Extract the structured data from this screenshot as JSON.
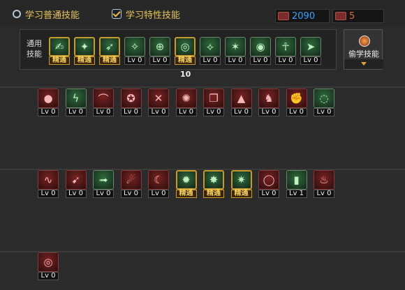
{
  "tabs": [
    {
      "label": "学习普通技能",
      "selected": false
    },
    {
      "label": "学习特性技能",
      "selected": true
    }
  ],
  "resources": {
    "sp": "2090",
    "tp": "5",
    "sp_color": "#3aa0ff",
    "tp_color": "#e56a2a"
  },
  "general": {
    "label": "通用技能",
    "slots": [
      {
        "icon": "scroll-man-icon",
        "tier": "gold",
        "level": "精通"
      },
      {
        "icon": "flame-arm-icon",
        "tier": "gold",
        "level": "精通"
      },
      {
        "icon": "runner-icon",
        "tier": "gold",
        "level": "精通"
      },
      {
        "icon": "wings-icon",
        "tier": "green",
        "level": "Lv 0"
      },
      {
        "icon": "crosshair-icon",
        "tier": "green",
        "level": "Lv 0"
      },
      {
        "icon": "target-icon",
        "tier": "gold",
        "level": "精通"
      },
      {
        "icon": "kick-icon",
        "tier": "green",
        "level": "Lv 0"
      },
      {
        "icon": "leap-icon",
        "tier": "green",
        "level": "Lv 0"
      },
      {
        "icon": "eye-icon",
        "tier": "green",
        "level": "Lv 0"
      },
      {
        "icon": "figure-icon",
        "tier": "green",
        "level": "Lv 0"
      },
      {
        "icon": "dash-icon",
        "tier": "green",
        "level": "Lv 0"
      }
    ],
    "count": "10"
  },
  "steal": {
    "label": "偷学技能"
  },
  "rows": [
    [
      {
        "icon": "orb-icon",
        "tier": "red",
        "level": "Lv 0"
      },
      {
        "icon": "lightning-figure-icon",
        "tier": "green",
        "level": "Lv 0"
      },
      {
        "icon": "bow-icon",
        "tier": "red",
        "level": "Lv 0"
      },
      {
        "icon": "emblem-icon",
        "tier": "red",
        "level": "Lv 0"
      },
      {
        "icon": "slash-cross-icon",
        "tier": "red",
        "level": "Lv 0"
      },
      {
        "icon": "burst-icon",
        "tier": "red",
        "level": "Lv 0"
      },
      {
        "icon": "book-icon",
        "tier": "red",
        "level": "Lv 0"
      },
      {
        "icon": "tower-icon",
        "tier": "red",
        "level": "Lv 0"
      },
      {
        "icon": "beast-icon",
        "tier": "red",
        "level": "Lv 0"
      },
      {
        "icon": "fist-icon",
        "tier": "red",
        "level": "Lv 0"
      },
      {
        "icon": "swirl-icon",
        "tier": "green",
        "level": "Lv 0"
      }
    ],
    [
      {
        "icon": "whip-icon",
        "tier": "red",
        "level": "Lv 0"
      },
      {
        "icon": "shot-icon",
        "tier": "red",
        "level": "Lv 0"
      },
      {
        "icon": "sprint-icon",
        "tier": "green",
        "level": "Lv 0"
      },
      {
        "icon": "fireball-icon",
        "tier": "red",
        "level": "Lv 0"
      },
      {
        "icon": "moon-icon",
        "tier": "red",
        "level": "Lv 0"
      },
      {
        "icon": "blast-icon",
        "tier": "gold",
        "level": "精通"
      },
      {
        "icon": "roar-icon",
        "tier": "gold",
        "level": "精通"
      },
      {
        "icon": "surge-icon",
        "tier": "gold",
        "level": "精通"
      },
      {
        "icon": "ring-icon",
        "tier": "red",
        "level": "Lv 0"
      },
      {
        "icon": "pillar-icon",
        "tier": "green",
        "level": "Lv 1"
      },
      {
        "icon": "flame-icon",
        "tier": "red",
        "level": "Lv 0"
      }
    ],
    [
      {
        "icon": "vortex-icon",
        "tier": "red",
        "level": "Lv 0"
      }
    ]
  ]
}
